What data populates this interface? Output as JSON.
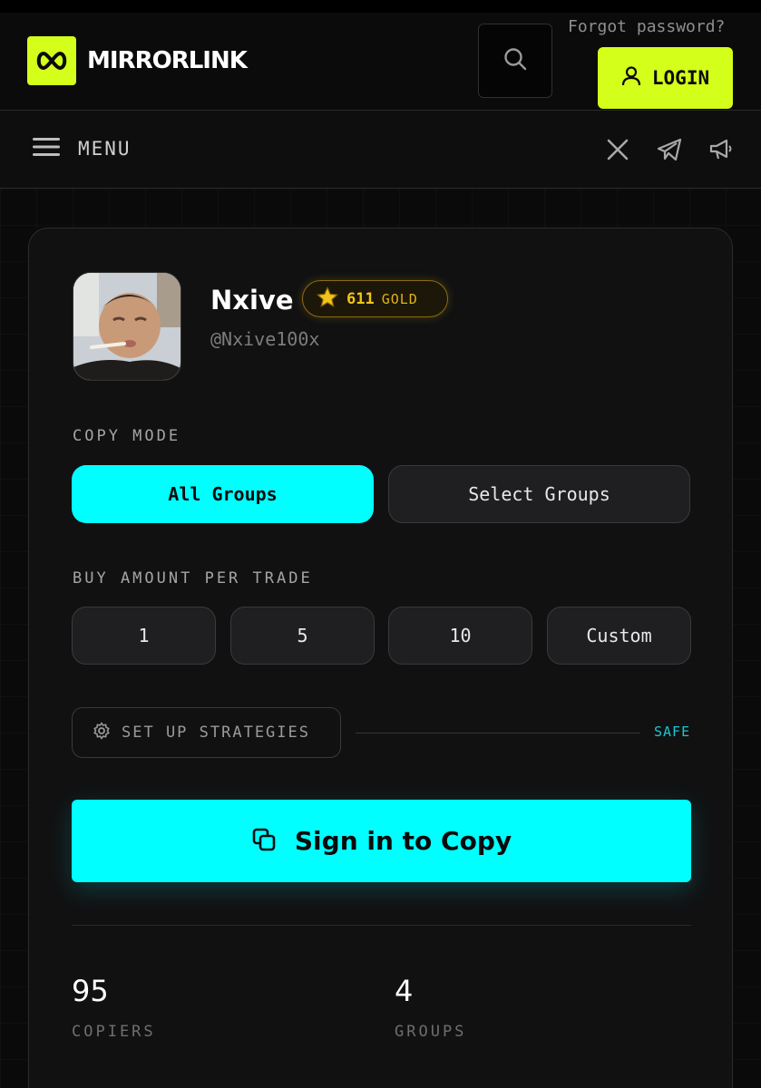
{
  "header": {
    "brand": "MIRRORLINK",
    "forgot_password": "Forgot password?",
    "login_label": "LOGIN",
    "icons": {
      "logo": "infinity-icon",
      "search": "search-icon",
      "login": "user-icon"
    }
  },
  "menubar": {
    "menu_label": "MENU",
    "socials": [
      "x-icon",
      "telegram-icon",
      "megaphone-icon"
    ]
  },
  "profile": {
    "name": "Nxive",
    "handle": "@Nxive100x",
    "badge": {
      "value": "611",
      "tier": "GOLD",
      "icon": "star-icon"
    }
  },
  "copy_mode": {
    "label": "COPY MODE",
    "options": [
      "All Groups",
      "Select Groups"
    ],
    "selected": "All Groups"
  },
  "buy_amount": {
    "label": "BUY AMOUNT PER TRADE",
    "options": [
      "1",
      "5",
      "10",
      "Custom"
    ]
  },
  "strategies": {
    "button_label": "SET UP STRATEGIES",
    "status": "SAFE",
    "icon": "gear-icon"
  },
  "cta": {
    "label": "Sign in to Copy",
    "icon": "copy-icon"
  },
  "stats": [
    {
      "value": "95",
      "label": "COPIERS"
    },
    {
      "value": "4",
      "label": "GROUPS"
    }
  ],
  "colors": {
    "accent_lime": "#d4ff1a",
    "accent_cyan": "#00ffff",
    "gold": "#f2c418",
    "background": "#0a0a0a"
  }
}
